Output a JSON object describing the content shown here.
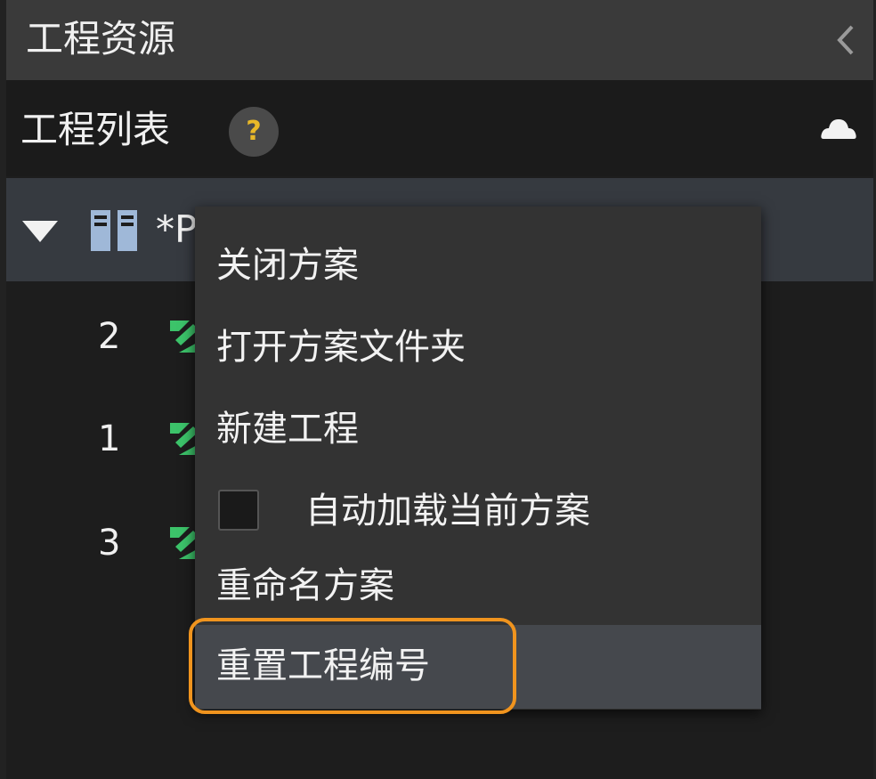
{
  "panel": {
    "title": "工程资源",
    "collapse_icon": "chevron-left-icon"
  },
  "subheader": {
    "title": "工程列表",
    "help_label": "?",
    "help_icon": "help-circle-icon",
    "cloud_icon": "cloud-icon"
  },
  "solution": {
    "name": "*P",
    "expand_icon": "triangle-down-icon",
    "icon": "solution-icon"
  },
  "projects": [
    {
      "number": "2",
      "icon": "project-icon"
    },
    {
      "number": "1",
      "icon": "project-icon"
    },
    {
      "number": "3",
      "icon": "project-icon"
    }
  ],
  "context_menu": {
    "items": [
      {
        "label": "关闭方案"
      },
      {
        "label": "打开方案文件夹"
      },
      {
        "label": "新建工程"
      },
      {
        "label": "自动加载当前方案",
        "type": "checkbox",
        "checked": false
      },
      {
        "label": "重命名方案"
      },
      {
        "label": "重置工程编号",
        "highlighted": true
      }
    ]
  },
  "colors": {
    "accent_callout": "#f0941e",
    "project_icon_green": "#3cc36a",
    "help_yellow": "#e8b828",
    "solution_icon_blue": "#9fb8d8"
  }
}
